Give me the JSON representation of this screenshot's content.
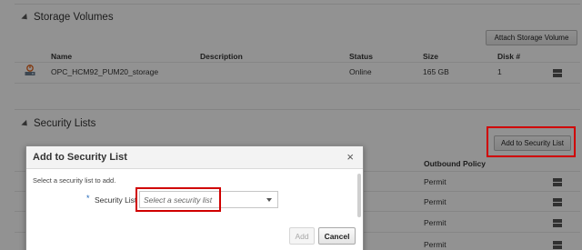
{
  "storage_volumes": {
    "title": "Storage Volumes",
    "attach_button": "Attach Storage Volume",
    "columns": [
      "Name",
      "Description",
      "Status",
      "Size",
      "Disk #"
    ],
    "rows": [
      {
        "name": "OPC_HCM92_PUM20_storage",
        "description": "",
        "status": "Online",
        "size": "165 GB",
        "disk": "1"
      }
    ]
  },
  "security_lists": {
    "title": "Security Lists",
    "add_button": "Add to Security List",
    "columns": [
      "Outbound Policy"
    ],
    "rows": [
      {
        "outbound_policy": "Permit"
      },
      {
        "outbound_policy": "Permit"
      },
      {
        "outbound_policy": "Permit"
      },
      {
        "outbound_policy": "Permit"
      }
    ]
  },
  "dialog": {
    "title": "Add to Security List",
    "close": "×",
    "hint": "Select a security list to add.",
    "required_mark": "*",
    "field_label": "Security List",
    "select_placeholder": "Select a security list",
    "add_label": "Add",
    "cancel_label": "Cancel"
  },
  "colors": {
    "highlight": "#d00000",
    "required": "#1a63b8",
    "disk_icon": "#e0621b"
  },
  "icons": {
    "row_actions": "hamburger-menu-icon",
    "volume": "storage-volume-icon",
    "section_toggle": "disclosure-triangle-icon",
    "close": "close-icon",
    "dropdown": "chevron-down-icon"
  }
}
